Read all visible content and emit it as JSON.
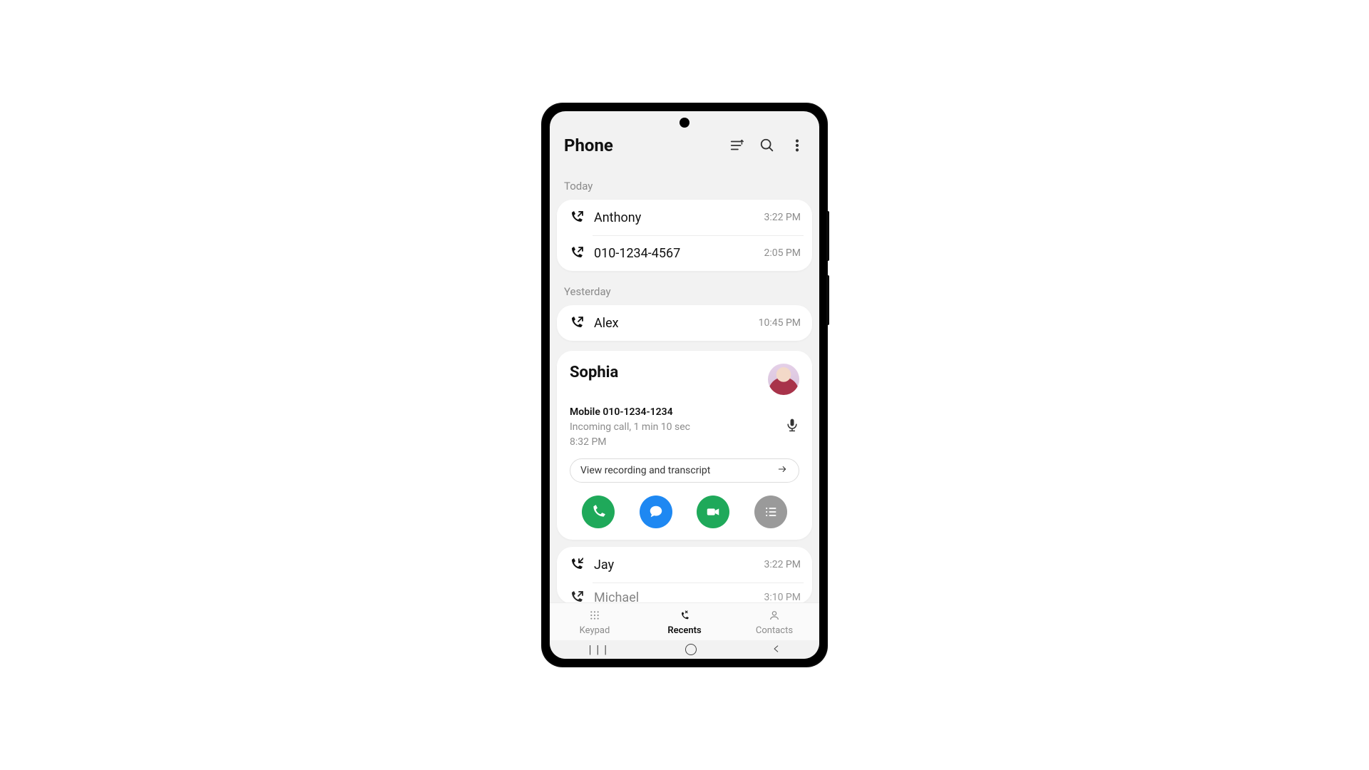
{
  "header": {
    "title": "Phone"
  },
  "sections": {
    "today_label": "Today",
    "yesterday_label": "Yesterday"
  },
  "today": [
    {
      "name": "Anthony",
      "time": "3:22 PM",
      "direction": "outgoing"
    },
    {
      "name": "010-1234-4567",
      "time": "2:05 PM",
      "direction": "outgoing"
    }
  ],
  "yesterday_simple": [
    {
      "name": "Alex",
      "time": "10:45 PM",
      "direction": "outgoing"
    }
  ],
  "expanded": {
    "name": "Sophia",
    "line1": "Mobile 010-1234-1234",
    "line2": "Incoming call, 1 min 10 sec",
    "line3": "8:32 PM",
    "pill_label": "View recording and transcript"
  },
  "yesterday_after": [
    {
      "name": "Jay",
      "time": "3:22 PM",
      "direction": "incoming"
    },
    {
      "name": "Michael",
      "time": "3:10 PM",
      "direction": "outgoing"
    }
  ],
  "tabs": {
    "keypad": "Keypad",
    "recents": "Recents",
    "contacts": "Contacts"
  }
}
